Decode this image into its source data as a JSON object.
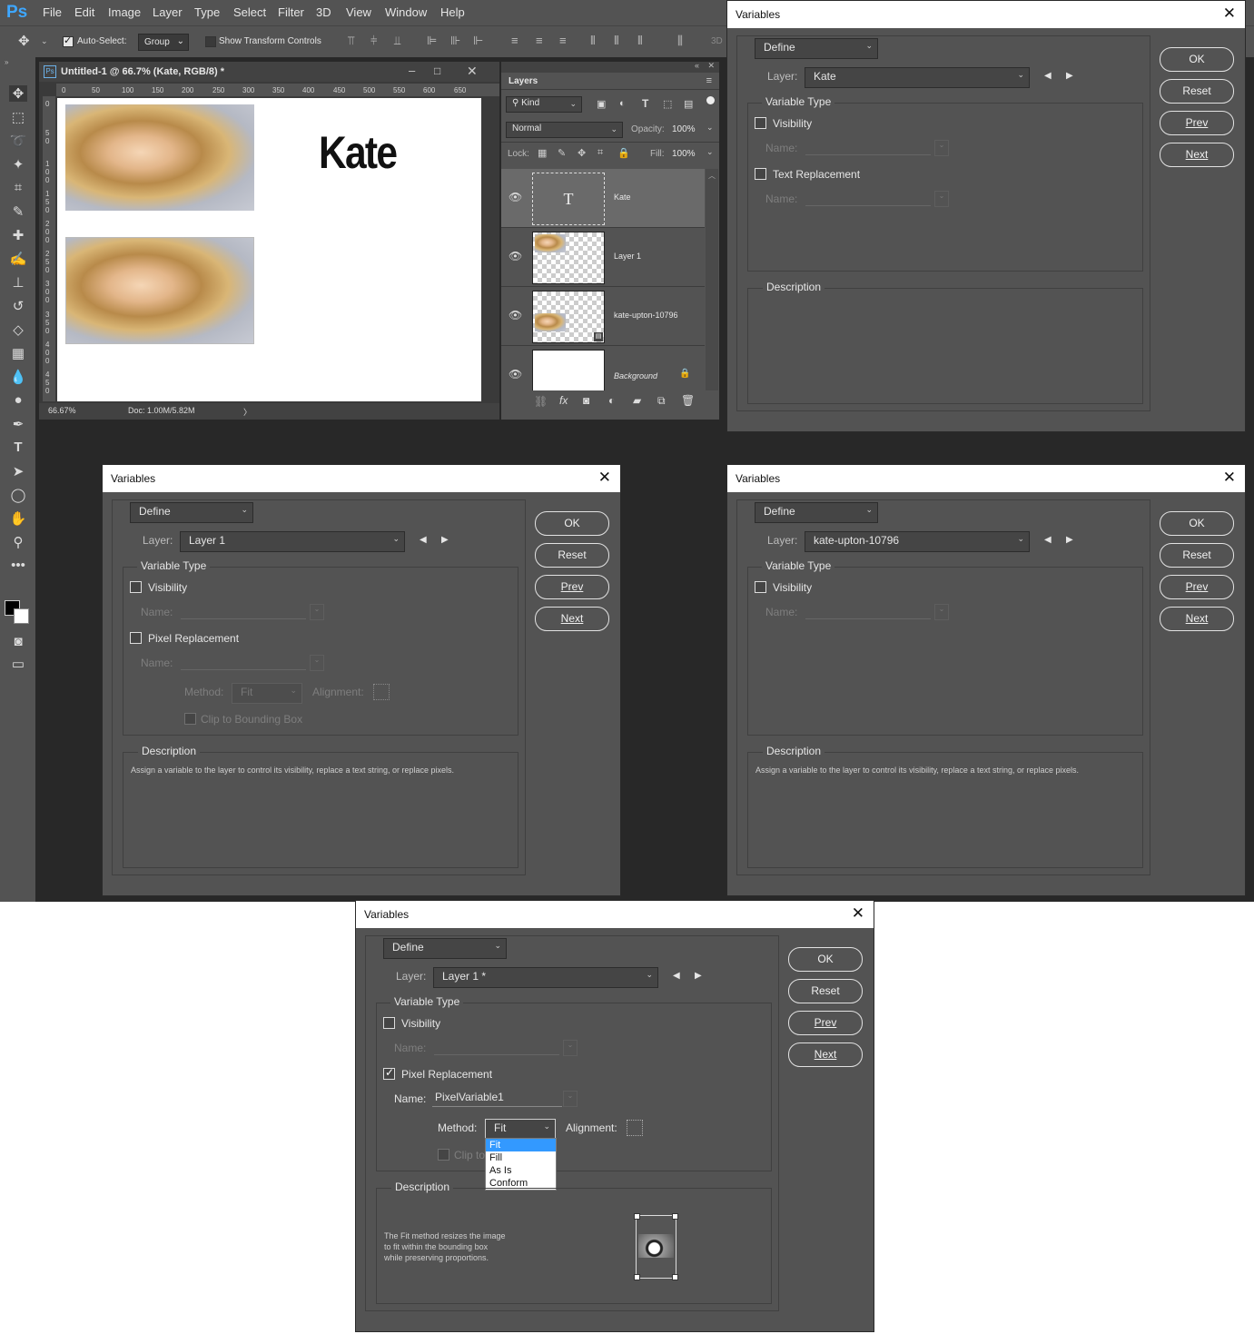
{
  "app": {
    "logo": "Ps",
    "menu": [
      "File",
      "Edit",
      "Image",
      "Layer",
      "Type",
      "Select",
      "Filter",
      "3D",
      "View",
      "Window",
      "Help"
    ],
    "options": {
      "auto_select_label": "Auto-Select:",
      "auto_select_value": "Group",
      "show_transform_label": "Show Transform Controls",
      "mode_3d": "3D"
    }
  },
  "document": {
    "title": "Untitled-1 @ 66.7% (Kate, RGB/8) *",
    "ruler_h": [
      "0",
      "50",
      "100",
      "150",
      "200",
      "250",
      "300",
      "350",
      "400",
      "450",
      "500",
      "550",
      "600",
      "650"
    ],
    "ruler_v": [
      "0",
      "50",
      "100",
      "150",
      "200",
      "250",
      "300",
      "350",
      "400",
      "450"
    ],
    "canvas_text": "Kate",
    "zoom": "66.67%",
    "doc_size": "Doc: 1.00M/5.82M"
  },
  "layers_panel": {
    "tab": "Layers",
    "filter_kind": "Kind",
    "blend_mode": "Normal",
    "opacity_label": "Opacity:",
    "opacity_value": "100%",
    "lock_label": "Lock:",
    "fill_label": "Fill:",
    "fill_value": "100%",
    "layers": [
      {
        "name": "Kate",
        "thumb_glyph": "T"
      },
      {
        "name": "Layer 1"
      },
      {
        "name": "kate-upton-10796"
      },
      {
        "name": "Background"
      }
    ]
  },
  "dialog_common": {
    "title": "Variables",
    "define": "Define",
    "layer_label": "Layer:",
    "variable_type": "Variable Type",
    "visibility": "Visibility",
    "name_label": "Name:",
    "text_replacement": "Text Replacement",
    "pixel_replacement": "Pixel Replacement",
    "method_label": "Method:",
    "alignment_label": "Alignment:",
    "clip_label": "Clip to Bounding Box",
    "clip_partial": "Clip to",
    "description_label": "Description",
    "ok": "OK",
    "reset": "Reset",
    "prev": "Prev",
    "next": "Next",
    "prev_arrow": "◀",
    "next_arrow": "▶"
  },
  "dialog1": {
    "layer_value": "Kate",
    "description": ""
  },
  "dialog2": {
    "layer_value": "Layer 1",
    "method_value": "Fit",
    "description": "Assign a variable to the layer to control its visibility, replace a text string, or replace pixels."
  },
  "dialog3": {
    "layer_value": "kate-upton-10796",
    "description": "Assign a variable to the layer to control its visibility, replace a text string, or replace pixels."
  },
  "dialog4": {
    "layer_value": "Layer 1 *",
    "pixel_checked": true,
    "name_value": "PixelVariable1",
    "method_value": "Fit",
    "method_options": [
      "Fit",
      "Fill",
      "As Is",
      "Conform"
    ],
    "description_lines": [
      "The Fit method resizes the image",
      "to fit within the bounding box",
      "while preserving proportions."
    ]
  }
}
